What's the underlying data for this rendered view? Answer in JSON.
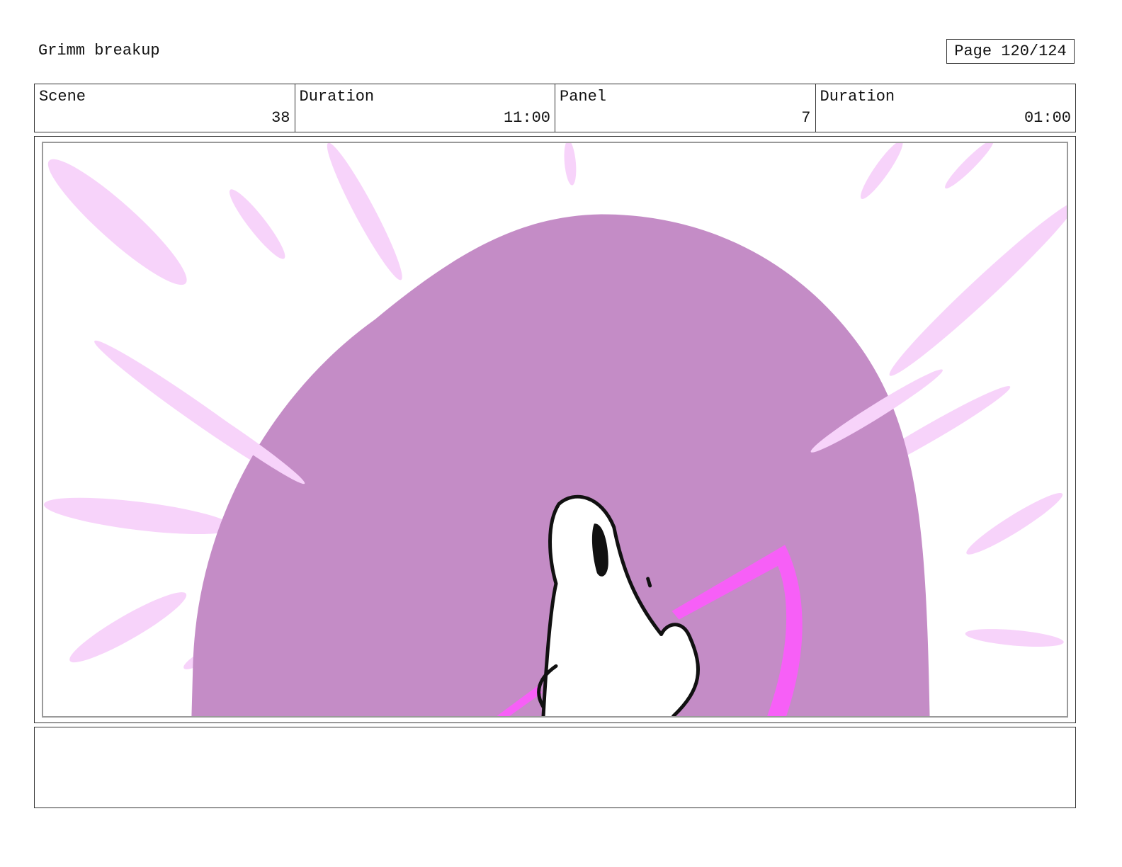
{
  "header": {
    "title": "Grimm breakup",
    "page_indicator": "Page 120/124"
  },
  "info_row": {
    "scene_label": "Scene",
    "scene_value": "38",
    "scene_duration_label": "Duration",
    "scene_duration_value": "11:00",
    "panel_label": "Panel",
    "panel_value": "7",
    "panel_duration_label": "Duration",
    "panel_duration_value": "01:00"
  },
  "panel": {
    "colors": {
      "mound": "#c48cc6",
      "rays": "#f7d3fa",
      "accent": "#f75ff7",
      "ink": "#111111",
      "figure": "#ffffff"
    }
  },
  "notes": {
    "text": ""
  }
}
